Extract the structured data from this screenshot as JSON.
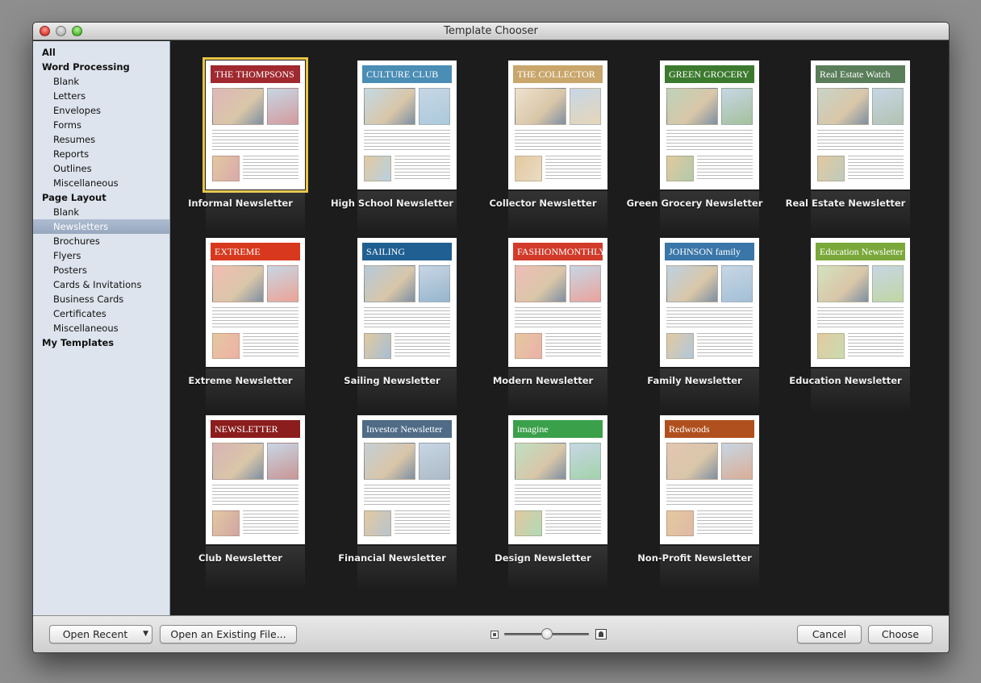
{
  "window": {
    "title": "Template Chooser"
  },
  "sidebar": {
    "items": [
      {
        "label": "All",
        "level": "top"
      },
      {
        "label": "Word Processing",
        "level": "top"
      },
      {
        "label": "Blank",
        "level": "sub"
      },
      {
        "label": "Letters",
        "level": "sub"
      },
      {
        "label": "Envelopes",
        "level": "sub"
      },
      {
        "label": "Forms",
        "level": "sub"
      },
      {
        "label": "Resumes",
        "level": "sub"
      },
      {
        "label": "Reports",
        "level": "sub"
      },
      {
        "label": "Outlines",
        "level": "sub"
      },
      {
        "label": "Miscellaneous",
        "level": "sub"
      },
      {
        "label": "Page Layout",
        "level": "top"
      },
      {
        "label": "Blank",
        "level": "sub"
      },
      {
        "label": "Newsletters",
        "level": "sub",
        "selected": true
      },
      {
        "label": "Brochures",
        "level": "sub"
      },
      {
        "label": "Flyers",
        "level": "sub"
      },
      {
        "label": "Posters",
        "level": "sub"
      },
      {
        "label": "Cards & Invitations",
        "level": "sub"
      },
      {
        "label": "Business Cards",
        "level": "sub"
      },
      {
        "label": "Certificates",
        "level": "sub"
      },
      {
        "label": "Miscellaneous",
        "level": "sub"
      },
      {
        "label": "My Templates",
        "level": "top"
      }
    ]
  },
  "templates": [
    {
      "name": "Informal Newsletter",
      "selected": true,
      "masthead": "THE THOMPSONS",
      "accent": "#a0282f"
    },
    {
      "name": "High School Newsletter",
      "masthead": "CULTURE CLUB",
      "accent": "#4a8db5"
    },
    {
      "name": "Collector Newsletter",
      "masthead": "THE COLLECTOR",
      "accent": "#c9a66b"
    },
    {
      "name": "Green Grocery Newsletter",
      "masthead": "GREEN GROCERY",
      "accent": "#3b7a2e"
    },
    {
      "name": "Real Estate Newsletter",
      "masthead": "Real Estate Watch",
      "accent": "#5a7d5a"
    },
    {
      "name": "Extreme Newsletter",
      "masthead": "EXTREME",
      "accent": "#d8391e"
    },
    {
      "name": "Sailing Newsletter",
      "masthead": "SAILING",
      "accent": "#1f5f92"
    },
    {
      "name": "Modern Newsletter",
      "masthead": "FASHIONMONTHLY",
      "accent": "#d23a2a"
    },
    {
      "name": "Family Newsletter",
      "masthead": "JOHNSON family",
      "accent": "#3a76a8"
    },
    {
      "name": "Education Newsletter",
      "masthead": "Education Newsletter",
      "accent": "#7aa83a"
    },
    {
      "name": "Club Newsletter",
      "masthead": "NEWSLETTER",
      "accent": "#8b1d1d"
    },
    {
      "name": "Financial Newsletter",
      "masthead": "Investor Newsletter",
      "accent": "#4f6b86"
    },
    {
      "name": "Design Newsletter",
      "masthead": "imagine",
      "accent": "#3aa04a"
    },
    {
      "name": "Non-Profit Newsletter",
      "masthead": "Redwoods",
      "accent": "#b0501e"
    }
  ],
  "footer": {
    "open_recent": "Open Recent",
    "open_existing": "Open an Existing File...",
    "cancel": "Cancel",
    "choose": "Choose",
    "zoom_level": 0.5
  }
}
